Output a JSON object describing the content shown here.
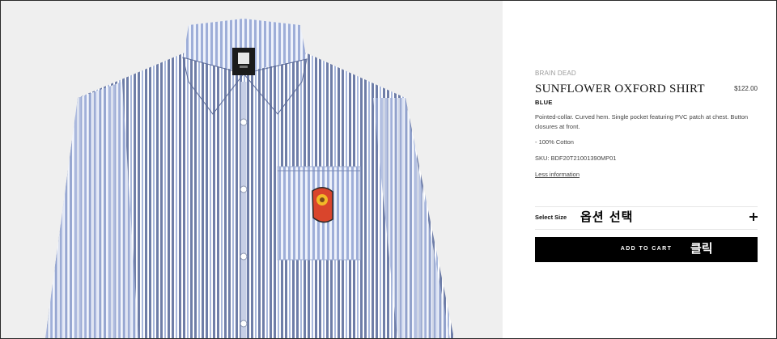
{
  "product": {
    "brand": "BRAIN DEAD",
    "title": "SUNFLOWER OXFORD SHIRT",
    "price": "$122.00",
    "color": "BLUE",
    "description": "Pointed-collar. Curved hem. Single pocket featuring PVC patch at chest. Button closures at front.",
    "composition": "- 100% Cotton",
    "sku": "SKU: BDF20T21001390MP01",
    "less_info_link": "Less information"
  },
  "size_selector": {
    "label": "Select Size",
    "annotation": "옵션 선택",
    "expand_icon": "plus-icon"
  },
  "cart": {
    "button_label": "ADD TO CART",
    "annotation": "클릭"
  },
  "image": {
    "subject": "blue-white-striped-shirt",
    "stripe_colors": [
      "#6f7ea8",
      "#a9b8dc",
      "#ffffff"
    ],
    "background": "#efefef",
    "patch_colors": [
      "#d9452c",
      "#f2b928"
    ]
  }
}
